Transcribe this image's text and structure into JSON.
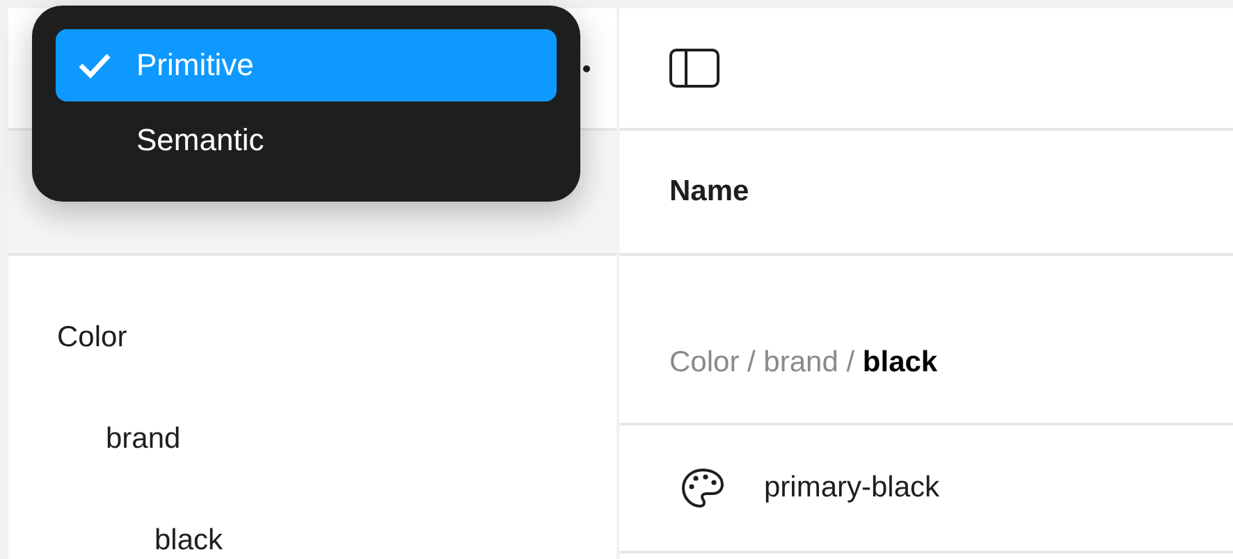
{
  "collection_menu": {
    "items": [
      {
        "label": "Primitive",
        "selected": true
      },
      {
        "label": "Semantic",
        "selected": false
      }
    ]
  },
  "sidebar": {
    "tree": [
      {
        "label": "Color",
        "children": [
          {
            "label": "brand",
            "children": [
              {
                "label": "black"
              }
            ]
          }
        ]
      }
    ]
  },
  "table": {
    "columns": [
      "Name"
    ],
    "groups": [
      {
        "path": "Color / brand / **black**",
        "rows": [
          {
            "name": "primary-black"
          }
        ]
      }
    ]
  }
}
